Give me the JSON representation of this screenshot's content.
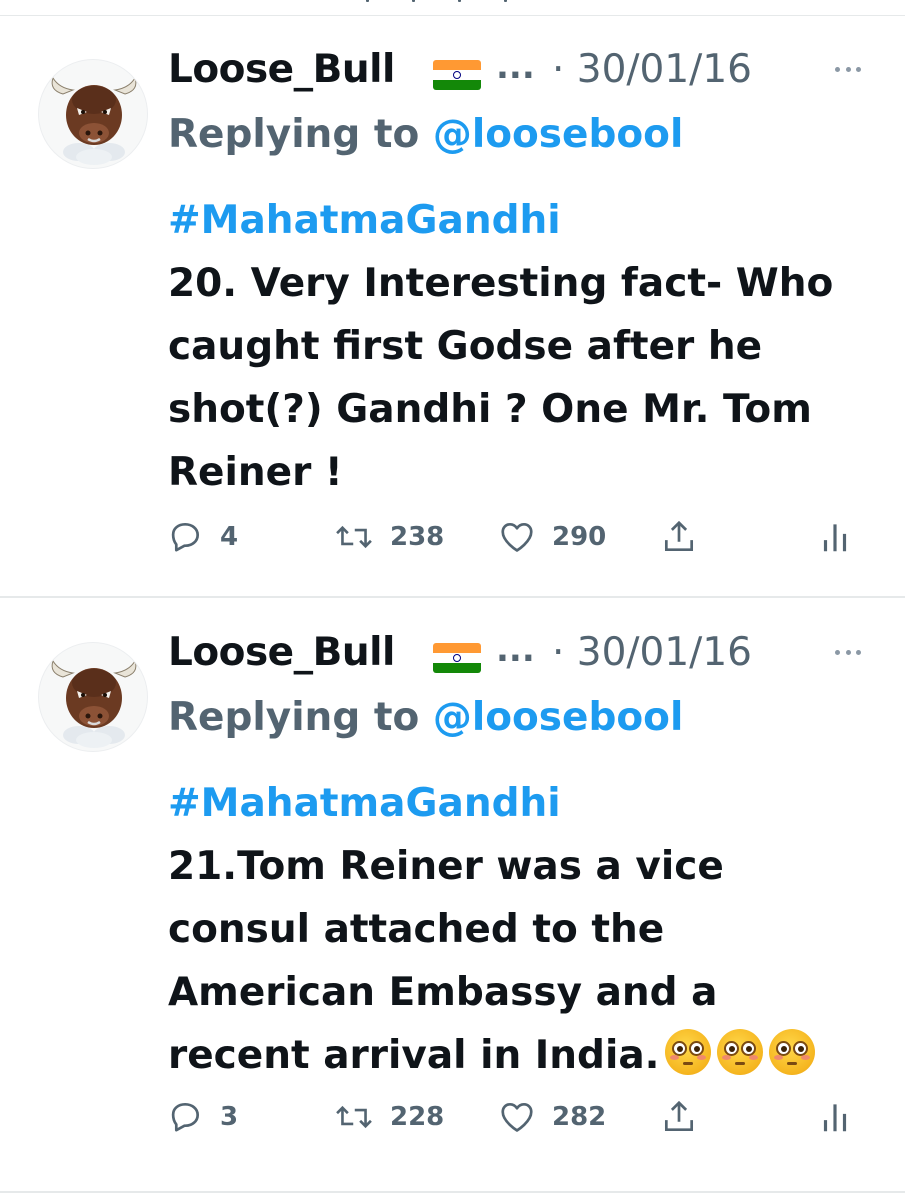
{
  "tweets": [
    {
      "author_name": "Loose_Bull",
      "name_truncation": "...",
      "date": "· 30/01/16",
      "replying_prefix": "Replying to ",
      "replying_handle": "@loosebool",
      "hashtag": "#MahatmaGandhi",
      "text_lines": [
        "20. Very Interesting fact- Who",
        "caught first Godse after he",
        "shot(?) Gandhi ? One Mr. Tom",
        "Reiner !"
      ],
      "emoji_count": 0,
      "stats": {
        "replies": "4",
        "retweets": "238",
        "likes": "290"
      }
    },
    {
      "author_name": "Loose_Bull",
      "name_truncation": "...",
      "date": "· 30/01/16",
      "replying_prefix": "Replying to ",
      "replying_handle": "@loosebool",
      "hashtag": "#MahatmaGandhi",
      "text_lines": [
        "21.Tom Reiner was a vice",
        "consul attached to the",
        "American Embassy and a",
        "recent arrival in India."
      ],
      "emoji_count": 3,
      "emoji": "flushed-face",
      "stats": {
        "replies": "3",
        "retweets": "228",
        "likes": "282"
      }
    }
  ],
  "icons": {
    "flag": "india-flag-icon",
    "more": "more-options-icon",
    "reply": "reply-icon",
    "retweet": "retweet-icon",
    "like": "heart-icon",
    "share": "share-icon",
    "analytics": "analytics-icon"
  },
  "colors": {
    "text": "#0f1419",
    "secondary": "#536471",
    "link": "#1d9bf0",
    "divider": "#e6e9ea"
  }
}
